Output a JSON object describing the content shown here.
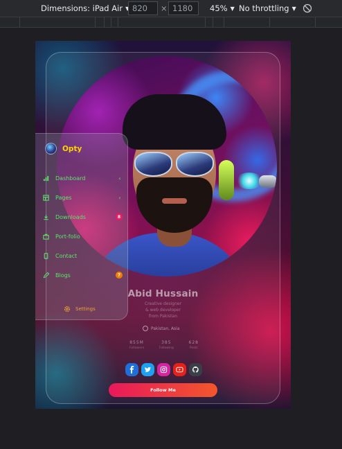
{
  "devtools": {
    "dimensions_label": "Dimensions: iPad Air",
    "width_value": "820",
    "times_symbol": "×",
    "height_value": "1180",
    "zoom_label": "45%",
    "throttling_label": "No throttling"
  },
  "sidebar": {
    "brand_name": "Opty",
    "items": [
      {
        "label": "Dashboard",
        "icon": "bar-chart-icon",
        "chevron": "‹",
        "badge": ""
      },
      {
        "label": "Pages",
        "icon": "layout-icon",
        "chevron": "‹",
        "badge": ""
      },
      {
        "label": "Downloads",
        "icon": "download-icon",
        "chevron": "",
        "badge": "8"
      },
      {
        "label": "Port-folio",
        "icon": "briefcase-icon",
        "chevron": "",
        "badge": ""
      },
      {
        "label": "Contact",
        "icon": "phone-icon",
        "chevron": "",
        "badge": ""
      },
      {
        "label": "Blogs",
        "icon": "pen-icon",
        "chevron": "",
        "badge": "7"
      }
    ],
    "settings_label": "Settings"
  },
  "profile": {
    "name": "Abid Hussain",
    "subtitle_lines": [
      "Creative designer",
      "& web developer",
      "from Pakistan"
    ],
    "location": "Pakistan, Asia",
    "stats": [
      {
        "value": "855M",
        "label": "Followers"
      },
      {
        "value": "385",
        "label": "Following"
      },
      {
        "value": "628",
        "label": "Posts"
      }
    ]
  },
  "socials": [
    {
      "name": "facebook",
      "color": "#1e6fd9"
    },
    {
      "name": "twitter",
      "color": "#1da1f2"
    },
    {
      "name": "instagram",
      "color": "#d6249f"
    },
    {
      "name": "youtube",
      "color": "#e62117"
    },
    {
      "name": "github",
      "color": "#3a3f47"
    }
  ],
  "follow_button_label": "Follow Me",
  "colors": {
    "brand": "#ffd400",
    "nav_text": "#5be56a",
    "settings": "#e8a53a",
    "badge_downloads": "#e91e63",
    "badge_blogs": "#f57c00"
  }
}
